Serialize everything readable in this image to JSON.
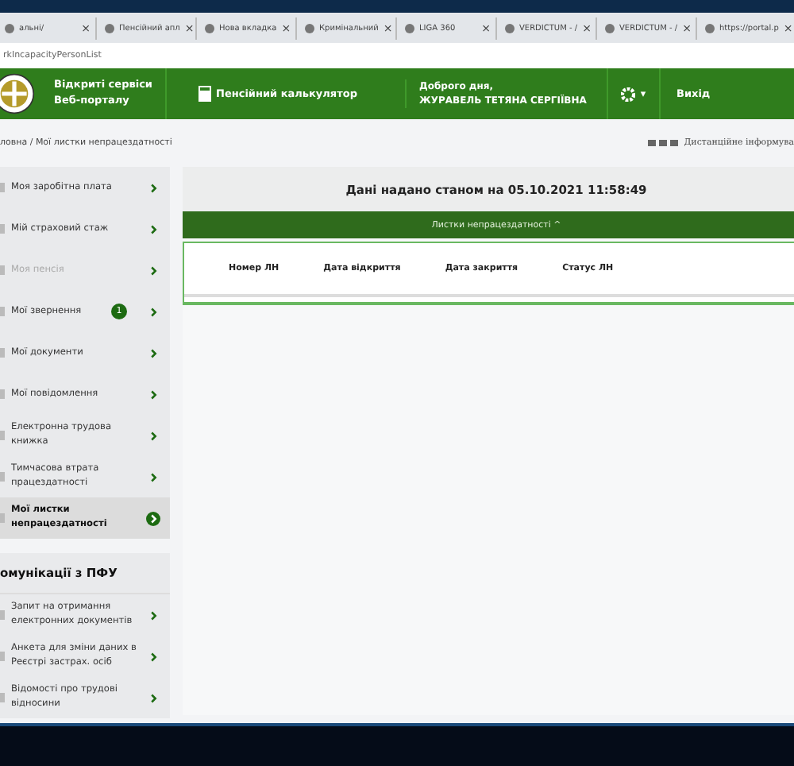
{
  "browser": {
    "tabs": [
      {
        "title": "альні/",
        "selected": false
      },
      {
        "title": "Пенсійний апл",
        "selected": false
      },
      {
        "title": "Нова вкладка",
        "selected": false
      },
      {
        "title": "Кримінальний",
        "selected": false
      },
      {
        "title": "LIGA 360",
        "selected": false
      },
      {
        "title": "VERDICTUM - /",
        "selected": false
      },
      {
        "title": "VERDICTUM - /",
        "selected": false
      },
      {
        "title": "https://portal.p",
        "selected": false
      }
    ],
    "close_glyph": "×",
    "address": "rkIncapacityPersonList"
  },
  "header": {
    "site_title": "Відкриті сервіси\nВеб-порталу",
    "calculator": "Пенсійний калькулятор",
    "greeting": "Доброго дня,\nЖУРАВЕЛЬ ТЕТЯНА СЕРГІЇВНА",
    "settings_caret": "▾",
    "logout": "Вихід"
  },
  "breadcrumb": "ловна / Мої листки непрацездатності",
  "remote_info": "Дистанційне інформува",
  "sidebar": {
    "items": [
      {
        "label": "Моя заробітна плата",
        "disabled": false,
        "selected": false
      },
      {
        "label": "Мій страховий стаж",
        "disabled": false,
        "selected": false
      },
      {
        "label": "Моя пенсія",
        "disabled": true,
        "selected": false
      },
      {
        "label": "Мої звернення",
        "badge": "1",
        "disabled": false,
        "selected": false
      },
      {
        "label": "Мої документи",
        "disabled": false,
        "selected": false
      },
      {
        "label": "Мої повідомлення",
        "disabled": false,
        "selected": false
      },
      {
        "label": "Електронна трудова книжка",
        "disabled": false,
        "selected": false
      },
      {
        "label": "Тимчасова втрата працездатності",
        "disabled": false,
        "selected": false
      },
      {
        "label": "Мої листки непрацездатності",
        "disabled": false,
        "selected": true
      }
    ],
    "section_title": "омунікації з ПФУ",
    "section_items": [
      {
        "label": "Запит на отримання електронних документів",
        "disabled": false,
        "selected": false
      },
      {
        "label": "Анкета для зміни даних в Реєстрі застрах. осіб",
        "disabled": false,
        "selected": false
      },
      {
        "label": "Відомості про трудові відносини",
        "disabled": false,
        "selected": false
      }
    ]
  },
  "main": {
    "status": "Дані надано станом на 05.10.2021 11:58:49",
    "panel_title": "Листки непрацездатності ^",
    "table": {
      "columns": [
        "Номер ЛН",
        "Дата відкриття",
        "Дата закриття",
        "Статус ЛН"
      ]
    }
  }
}
